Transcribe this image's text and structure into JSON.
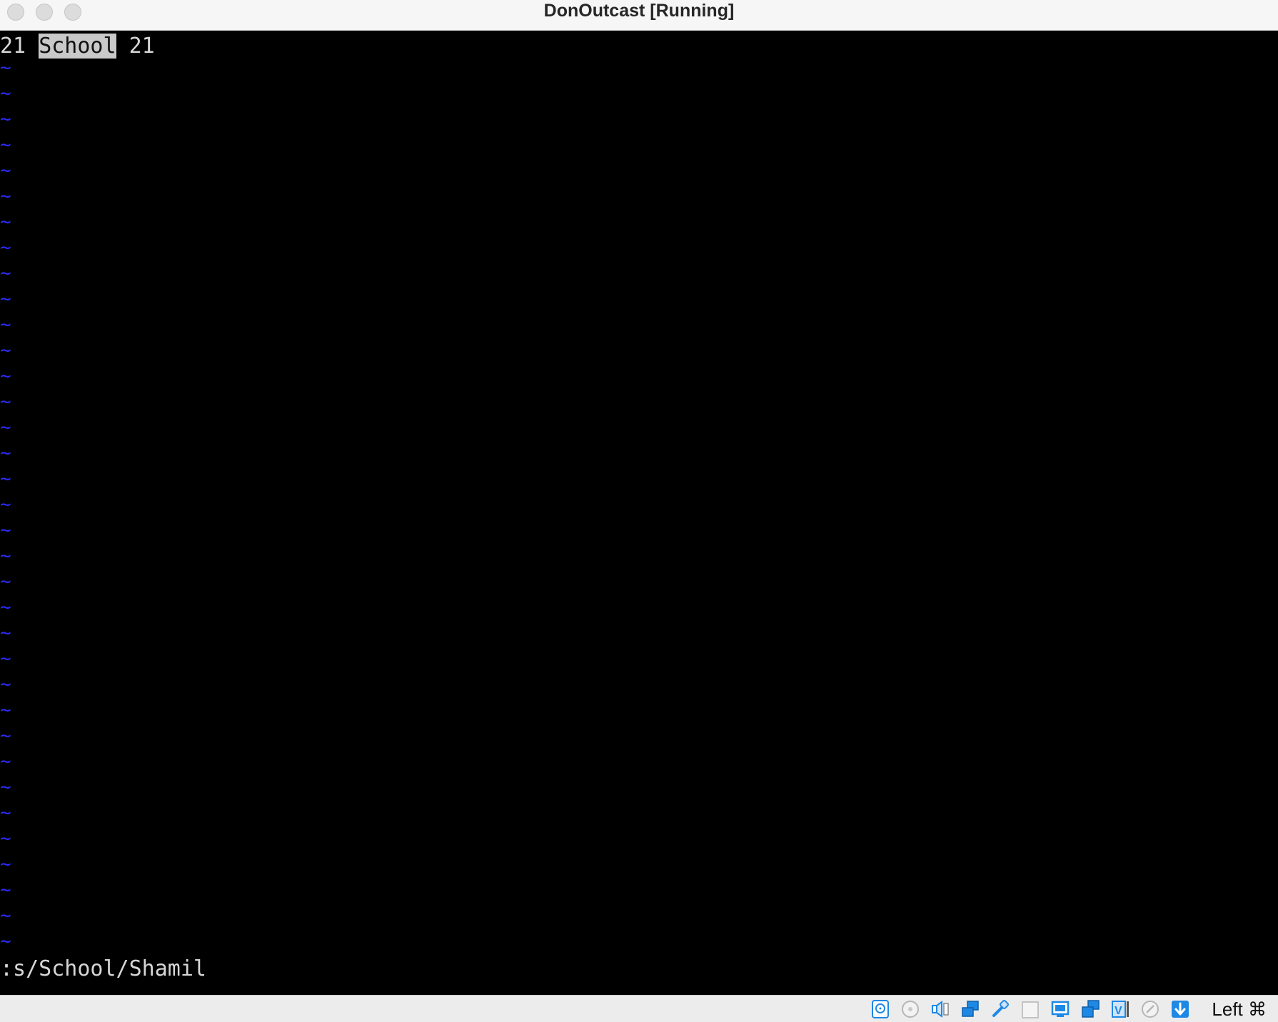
{
  "window": {
    "title": "DonOutcast [Running]"
  },
  "terminal": {
    "line1_before": "21 ",
    "line1_highlight": "School",
    "line1_after": " 21",
    "tilde": "~",
    "tilde_count": 35,
    "command": ":s/School/Shamil"
  },
  "statusbar": {
    "icons": [
      "hard-disk-icon",
      "optical-drive-icon",
      "audio-icon",
      "network-icon",
      "usb-icon",
      "shared-folders-icon",
      "display-icon",
      "screen-capture-icon",
      "video-recording-icon",
      "mouse-integration-icon",
      "keyboard-capture-icon"
    ],
    "host_key": "Left ⌘"
  },
  "colors": {
    "terminal_bg": "#000000",
    "terminal_fg": "#d6d6d6",
    "tilde": "#2b2bff",
    "highlight_bg": "#c9c9c9",
    "icon_blue": "#1e88e5"
  }
}
